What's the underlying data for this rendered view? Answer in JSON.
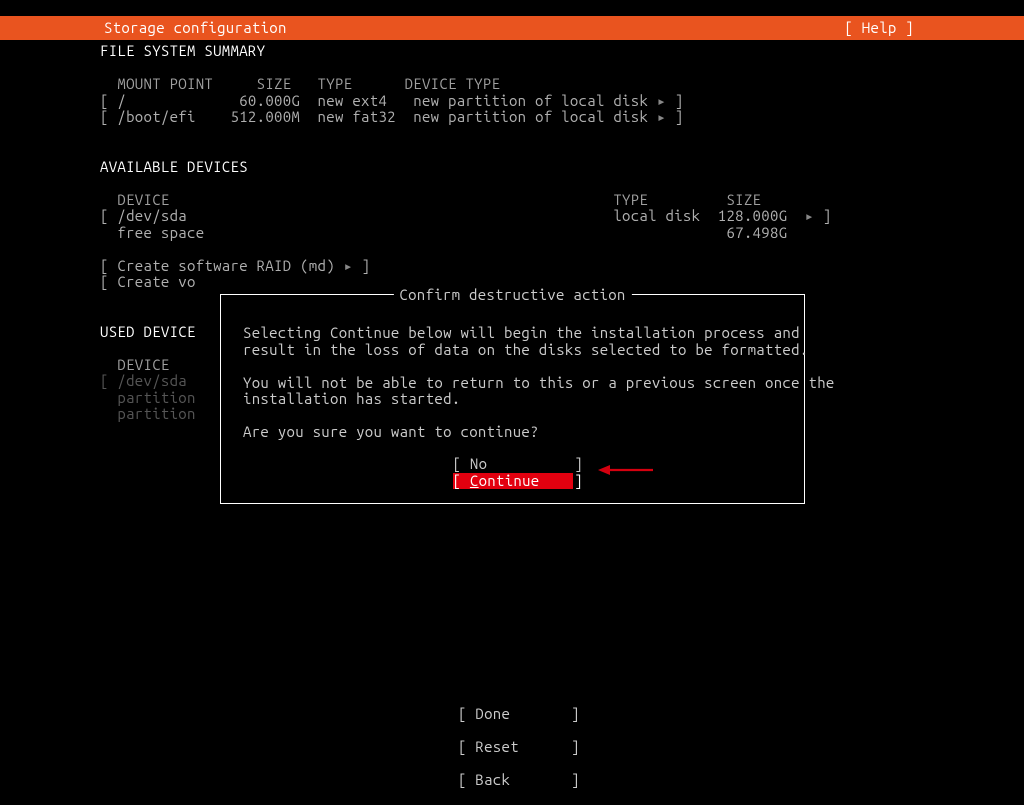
{
  "topbar": {
    "title": "Storage configuration",
    "help": "[ Help ]"
  },
  "sections": {
    "fs_summary": {
      "heading": "FILE SYSTEM SUMMARY",
      "cols": {
        "mount": "MOUNT POINT",
        "size": "SIZE",
        "type": "TYPE",
        "device_type": "DEVICE TYPE"
      },
      "rows": [
        {
          "lb": "[",
          "mount": "/",
          "size": "60.000G",
          "type": "new ext4",
          "device_type": "new partition of local disk",
          "arrow": "▸",
          "rb": "]"
        },
        {
          "lb": "[",
          "mount": "/boot/efi",
          "size": "512.000M",
          "type": "new fat32",
          "device_type": "new partition of local disk",
          "arrow": "▸",
          "rb": "]"
        }
      ]
    },
    "available": {
      "heading": "AVAILABLE DEVICES",
      "cols": {
        "device": "DEVICE",
        "type": "TYPE",
        "size": "SIZE"
      },
      "rows": [
        {
          "lb": "[",
          "device": "/dev/sda",
          "type": "local disk",
          "size": "128.000G",
          "arrow": "▸",
          "rb": "]"
        },
        {
          "lb": " ",
          "device": "free space",
          "type": "",
          "size": "67.498G",
          "arrow": " ",
          "rb": " "
        }
      ],
      "actions": {
        "raid": "Create software RAID (md)",
        "vo": "Create vo"
      }
    },
    "used": {
      "heading": "USED DEVICE",
      "label_device": "DEVICE",
      "rows": [
        {
          "lb": "[",
          "device": "/dev/sda"
        },
        {
          "lb": " ",
          "device": "partition"
        },
        {
          "lb": " ",
          "device": "partition"
        }
      ]
    }
  },
  "dialog": {
    "title": "Confirm destructive action",
    "p1a": "Selecting Continue below will begin the installation process and",
    "p1b": "result in the loss of data on the disks selected to be formatted.",
    "p2a": "You will not be able to return to this or a previous screen once the",
    "p2b": "installation has started.",
    "p3": "Are you sure you want to continue?",
    "no_label": "No",
    "continue_label": "Continue"
  },
  "footer": {
    "done": "Done",
    "reset": "Reset",
    "back": "Back"
  }
}
